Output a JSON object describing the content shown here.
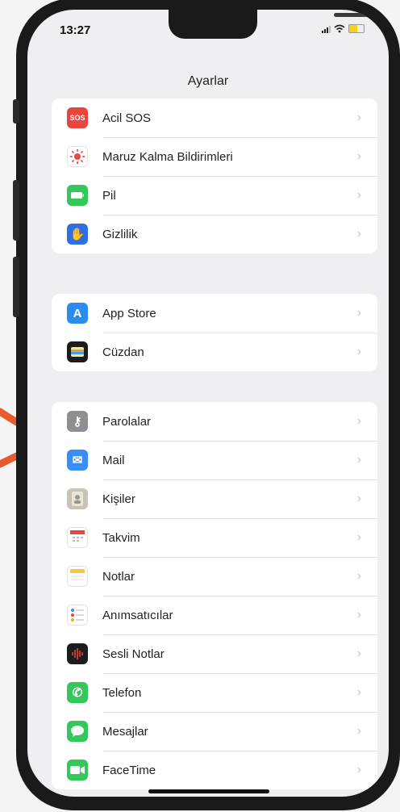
{
  "status_bar": {
    "time": "13:27"
  },
  "nav": {
    "title": "Ayarlar"
  },
  "groups": [
    {
      "items": [
        {
          "label": "Acil SOS",
          "icon": "sos-icon",
          "icon_text": "SOS",
          "color": "#e8453c"
        },
        {
          "label": "Maruz Kalma Bildirimleri",
          "icon": "exposure-icon",
          "icon_text": "",
          "color": "#ffffff"
        },
        {
          "label": "Pil",
          "icon": "battery-icon",
          "icon_text": "",
          "color": "#34c759"
        },
        {
          "label": "Gizlilik",
          "icon": "hand-icon",
          "icon_text": "✋",
          "color": "#2f6fe4"
        }
      ]
    },
    {
      "items": [
        {
          "label": "App Store",
          "icon": "app-store-icon",
          "icon_text": "A",
          "color": "#2b8cf0"
        },
        {
          "label": "Cüzdan",
          "icon": "wallet-icon",
          "icon_text": "",
          "color": "#1c1c1e"
        }
      ]
    },
    {
      "items": [
        {
          "label": "Parolalar",
          "icon": "key-icon",
          "icon_text": "⚷",
          "color": "#8e8e93"
        },
        {
          "label": "Mail",
          "icon": "mail-icon",
          "icon_text": "✉",
          "color": "#3a8df5"
        },
        {
          "label": "Kişiler",
          "icon": "contacts-icon",
          "icon_text": "",
          "color": "#c9c3b4"
        },
        {
          "label": "Takvim",
          "icon": "calendar-icon",
          "icon_text": "",
          "color": "#ffffff"
        },
        {
          "label": "Notlar",
          "icon": "notes-icon",
          "icon_text": "",
          "color": "#ffffff"
        },
        {
          "label": "Anımsatıcılar",
          "icon": "reminders-icon",
          "icon_text": "",
          "color": "#ffffff"
        },
        {
          "label": "Sesli Notlar",
          "icon": "voice-memos-icon",
          "icon_text": "",
          "color": "#1c1c1e"
        },
        {
          "label": "Telefon",
          "icon": "phone-icon",
          "icon_text": "✆",
          "color": "#34c759"
        },
        {
          "label": "Mesajlar",
          "icon": "messages-icon",
          "icon_text": "",
          "color": "#34c759"
        },
        {
          "label": "FaceTime",
          "icon": "facetime-icon",
          "icon_text": "",
          "color": "#34c759"
        }
      ]
    }
  ],
  "chevron": "›",
  "accent_arrow_color": "#e85a2c"
}
